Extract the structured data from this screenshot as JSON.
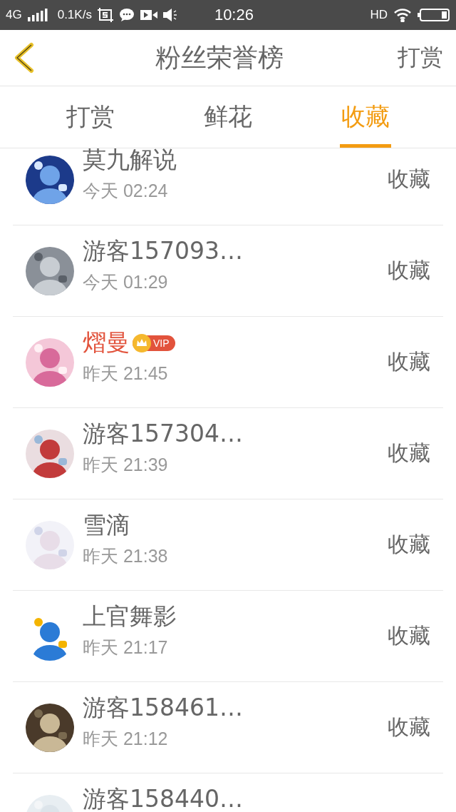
{
  "status_bar": {
    "network": "4G",
    "speed": "0.1K/s",
    "time": "10:26",
    "hd": "HD"
  },
  "header": {
    "title": "粉丝荣誉榜",
    "action": "打赏"
  },
  "tabs": [
    {
      "label": "打赏",
      "selected": false
    },
    {
      "label": "鲜花",
      "selected": false
    },
    {
      "label": "收藏",
      "selected": true
    }
  ],
  "rows": [
    {
      "name": "莫九解说",
      "time": "今天 02:24",
      "action": "收藏",
      "vip": false
    },
    {
      "name": "游客157093…",
      "time": "今天 01:29",
      "action": "收藏",
      "vip": false
    },
    {
      "name": "熠曼",
      "time": "昨天 21:45",
      "action": "收藏",
      "vip": true,
      "badge": "VIP"
    },
    {
      "name": "游客157304…",
      "time": "昨天 21:39",
      "action": "收藏",
      "vip": false
    },
    {
      "name": "雪滴",
      "time": "昨天 21:38",
      "action": "收藏",
      "vip": false
    },
    {
      "name": "上官舞影",
      "time": "昨天 21:17",
      "action": "收藏",
      "vip": false
    },
    {
      "name": "游客158461…",
      "time": "昨天 21:12",
      "action": "收藏",
      "vip": false
    },
    {
      "name": "游客158440…",
      "vip": false
    }
  ]
}
